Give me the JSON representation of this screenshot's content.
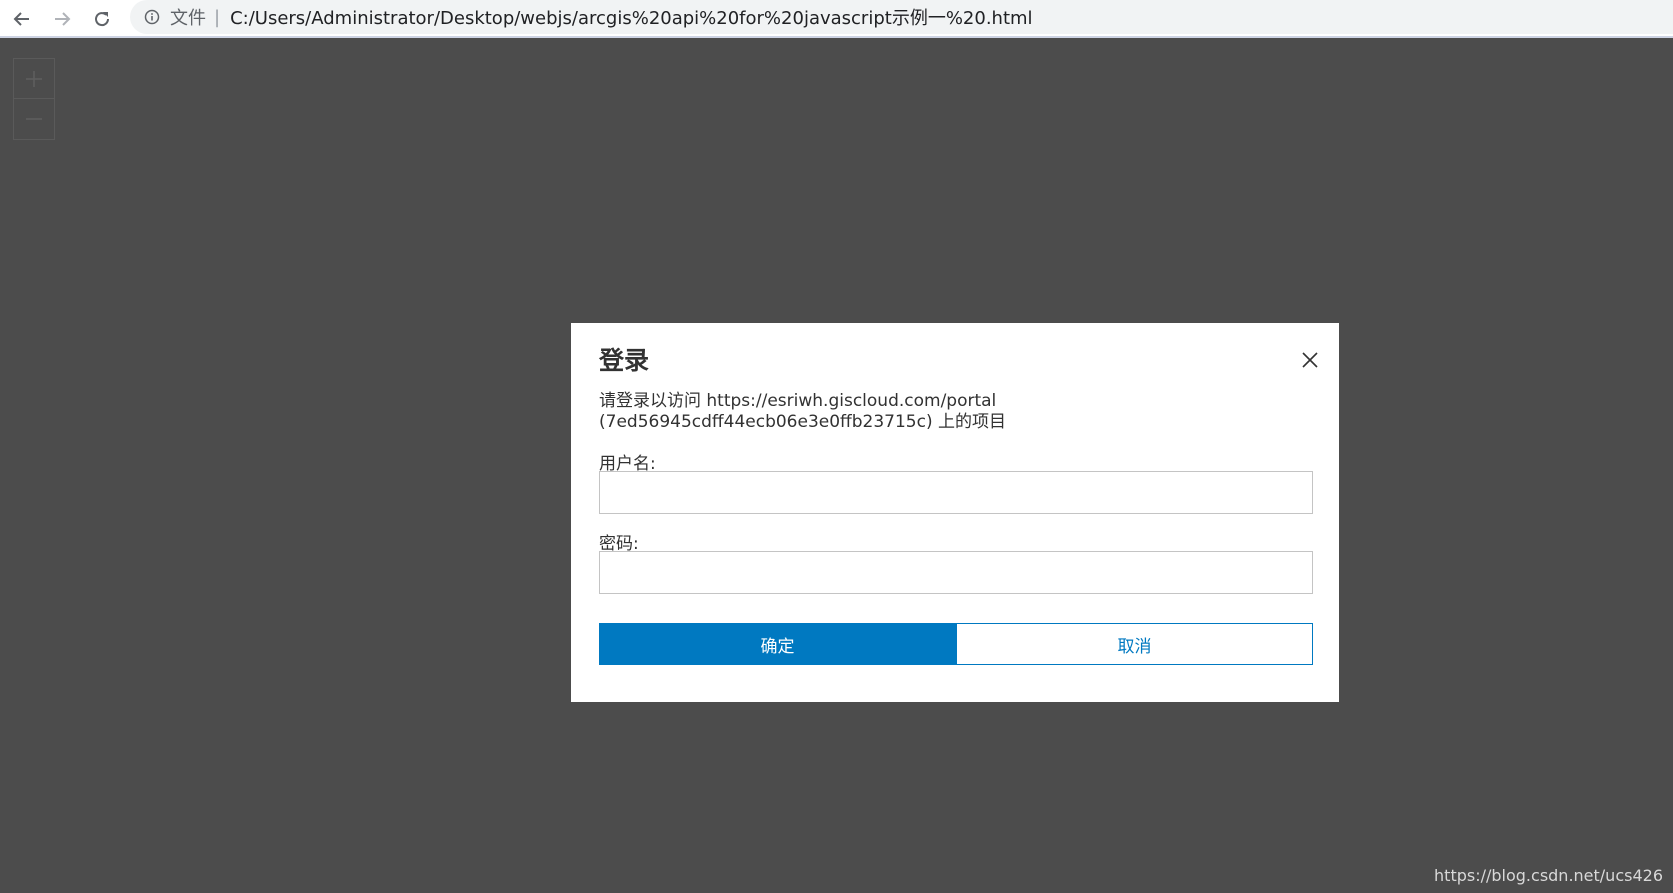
{
  "browser": {
    "file_label": "文件",
    "separator": "|",
    "url": "C:/Users/Administrator/Desktop/webjs/arcgis%20api%20for%20javascript示例一%20.html"
  },
  "icons": {
    "back": "arrow-left-icon",
    "forward": "arrow-right-icon",
    "reload": "reload-icon",
    "info": "info-icon",
    "zoom_in": "plus-icon",
    "zoom_out": "minus-icon",
    "close": "close-icon"
  },
  "dialog": {
    "title": "登录",
    "message": "请登录以访问 https://esriwh.giscloud.com/portal (7ed56945cdff44ecb06e3e0ffb23715c) 上的项目",
    "username_label": "用户名:",
    "username_value": "",
    "password_label": "密码:",
    "password_value": "",
    "ok_label": "确定",
    "cancel_label": "取消"
  },
  "watermark": "https://blog.csdn.net/ucs426",
  "colors": {
    "accent": "#0079c1",
    "overlay": "#4c4c4c",
    "dialog_bg": "#ffffff"
  }
}
